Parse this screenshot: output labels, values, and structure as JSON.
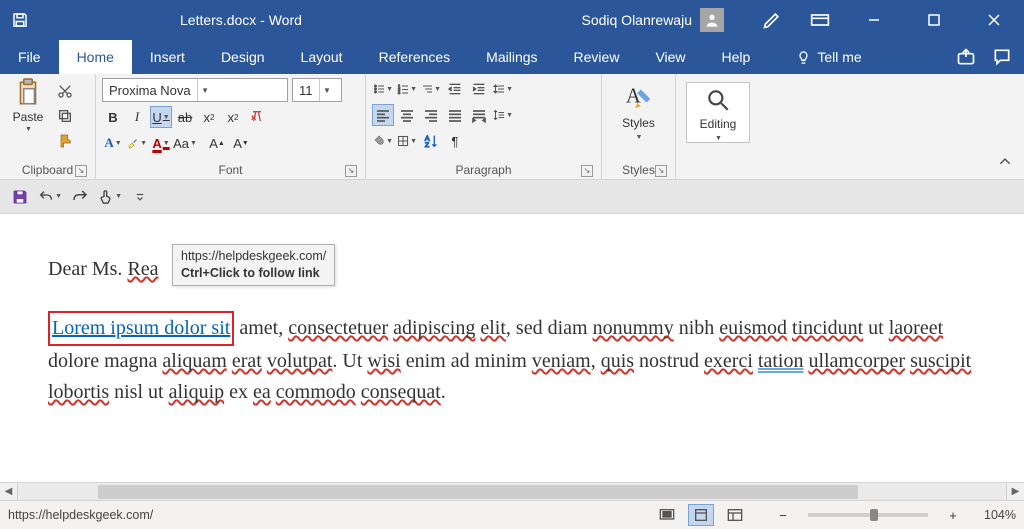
{
  "titlebar": {
    "doc_title": "Letters.docx  -  Word",
    "username": "Sodiq Olanrewaju"
  },
  "tabs": {
    "file": "File",
    "home": "Home",
    "insert": "Insert",
    "design": "Design",
    "layout": "Layout",
    "references": "References",
    "mailings": "Mailings",
    "review": "Review",
    "view": "View",
    "help": "Help",
    "tell_me": "Tell me"
  },
  "font": {
    "name": "Proxima Nova",
    "size": "11"
  },
  "ribbon_labels": {
    "clipboard": "Clipboard",
    "font": "Font",
    "paragraph": "Paragraph",
    "styles": "Styles",
    "paste": "Paste",
    "styles_btn": "Styles",
    "editing": "Editing"
  },
  "document": {
    "greeting_prefix": "Dear Ms. ",
    "greeting_name": "Rea",
    "link_text": "Lorem ipsum dolor sit",
    "tooltip_url": "https://helpdeskgeek.com/",
    "tooltip_action": "Ctrl+Click to follow link",
    "body_after_link": " amet, ",
    "w1": "consectetuer",
    "sp1": " ",
    "w2": "adipiscing",
    "sp2": " ",
    "w3": "elit",
    "after1": ", sed diam ",
    "w4": "nonummy",
    "line2a": "nibh ",
    "w5": "euismod",
    "line2b": " ",
    "w6": "tincidunt",
    "line2c": " ut ",
    "w7": "laoreet",
    "line2d": " dolore magna ",
    "w8": "aliquam",
    "line2e": " ",
    "w9": "erat",
    "line2f": " ",
    "w10": "volutpat",
    "line2g": ". Ut ",
    "w11": "wisi",
    "line3a": "enim ad minim ",
    "w12": "veniam",
    "line3b": ", ",
    "w13": "quis",
    "line3c": " nostrud ",
    "w14": "exerci",
    "line3d": " ",
    "w15": "tation",
    "line3e": " ",
    "w16": "ullamcorper",
    "line3f": " ",
    "w17": "suscipit",
    "line3g": " ",
    "w18": "lobortis",
    "line4a": "nisl ut ",
    "w19": "aliquip",
    "line4b": " ex ",
    "w20": "ea",
    "line4c": " ",
    "w21": "commodo",
    "line4d": " ",
    "w22": "consequat",
    "line4e": "."
  },
  "statusbar": {
    "url": "https://helpdeskgeek.com/",
    "zoom": "104%"
  }
}
